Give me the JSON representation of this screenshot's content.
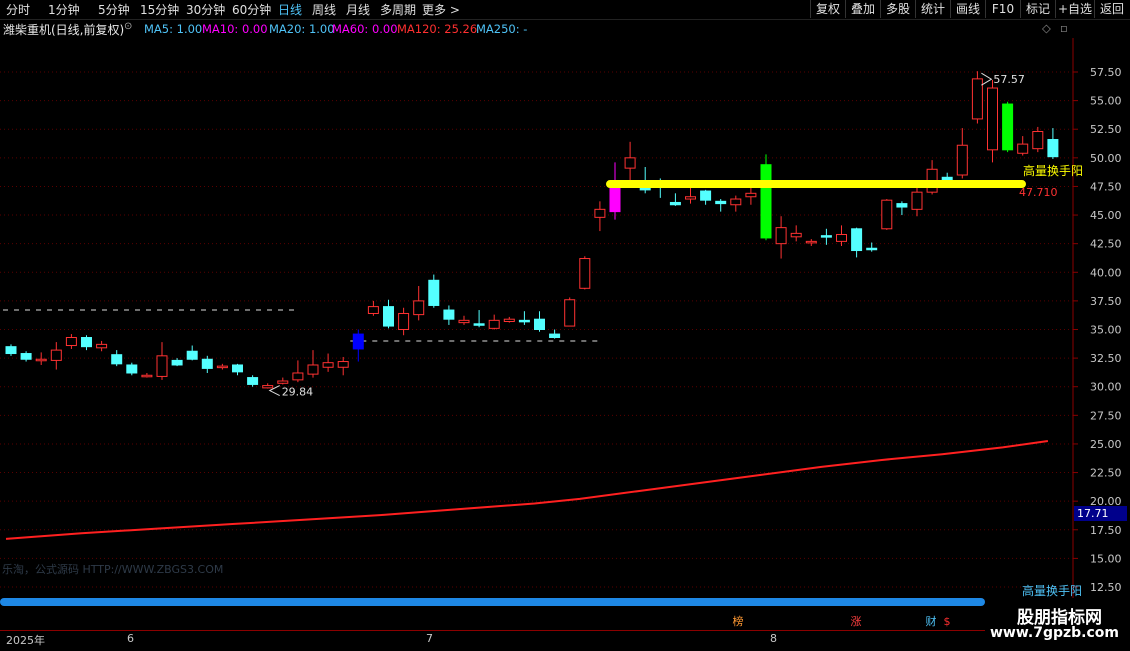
{
  "toolbar": {
    "tabs": [
      "分时",
      "1分钟",
      "5分钟",
      "15分钟",
      "30分钟",
      "60分钟",
      "日线",
      "周线",
      "月线",
      "多周期",
      "更多 >"
    ],
    "active_tab": "日线",
    "right_buttons": [
      "复权",
      "叠加",
      "多股",
      "统计",
      "画线",
      "F10",
      "标记",
      "+自选",
      "返回"
    ]
  },
  "title": {
    "stock": "潍柴重机(日线,前复权)",
    "ma_items": [
      {
        "label": "MA5: 1.00",
        "color": "#4fc3f7"
      },
      {
        "label": "MA10: 0.00",
        "color": "#ff00ff"
      },
      {
        "label": "MA20: 1.00",
        "color": "#4fc3f7"
      },
      {
        "label": "MA60: 0.00",
        "color": "#ff00ff"
      },
      {
        "label": "MA120: 25.26",
        "color": "#ff3030"
      },
      {
        "label": "MA250: -",
        "color": "#4fc3f7"
      }
    ]
  },
  "annotations": {
    "high": "57.57",
    "low": "29.84",
    "signal": "高量换手阳",
    "signal_value": "47.710",
    "current_price": "17.71",
    "signal_bottom": "高量换手阳"
  },
  "watermark": "乐淘，公式源码 HTTP://WWW.ZBGS3.COM",
  "dates": [
    "2025年",
    "6",
    "7",
    "8"
  ],
  "markers": [
    {
      "text": "榜",
      "color": "#ff9933"
    },
    {
      "text": "涨",
      "color": "#ff4040"
    },
    {
      "text": "财",
      "color": "#4fc3f7"
    },
    {
      "text": "$",
      "color": "#ff3030"
    }
  ],
  "logo": {
    "name": "股朋指标网",
    "url": "www.7gpzb.com"
  },
  "colors": {
    "up": "#ff3232",
    "down": "#54ffff",
    "ma120": "#ff2020",
    "signal_line": "#ffff00"
  },
  "chart_data": {
    "type": "candlestick",
    "ylim": [
      12.5,
      57.5
    ],
    "yticks": [
      "57.50",
      "55.00",
      "52.50",
      "50.00",
      "47.50",
      "45.00",
      "42.50",
      "40.00",
      "37.50",
      "35.00",
      "32.50",
      "30.00",
      "27.50",
      "25.00",
      "22.50",
      "20.00",
      "17.50",
      "15.00",
      "12.50"
    ],
    "high_marker": 57.57,
    "low_marker": 29.84,
    "signal_level": 47.71,
    "candles": [
      {
        "o": 33.5,
        "c": 32.9,
        "h": 33.7,
        "l": 32.7
      },
      {
        "o": 32.9,
        "c": 32.4,
        "h": 33.1,
        "l": 32.2
      },
      {
        "o": 32.3,
        "c": 32.4,
        "h": 33.0,
        "l": 31.9
      },
      {
        "o": 32.3,
        "c": 33.2,
        "h": 33.9,
        "l": 31.5
      },
      {
        "o": 33.6,
        "c": 34.3,
        "h": 34.6,
        "l": 33.3
      },
      {
        "o": 34.3,
        "c": 33.5,
        "h": 34.5,
        "l": 33.2
      },
      {
        "o": 33.4,
        "c": 33.7,
        "h": 34.0,
        "l": 33.1
      },
      {
        "o": 32.8,
        "c": 32.0,
        "h": 33.2,
        "l": 31.8
      },
      {
        "o": 31.9,
        "c": 31.2,
        "h": 32.1,
        "l": 31.0
      },
      {
        "o": 30.9,
        "c": 31.0,
        "h": 31.2,
        "l": 30.8
      },
      {
        "o": 30.9,
        "c": 32.7,
        "h": 33.9,
        "l": 30.6
      },
      {
        "o": 32.3,
        "c": 31.9,
        "h": 32.5,
        "l": 31.8
      },
      {
        "o": 33.1,
        "c": 32.4,
        "h": 33.6,
        "l": 32.3
      },
      {
        "o": 32.4,
        "c": 31.6,
        "h": 32.7,
        "l": 31.2
      },
      {
        "o": 31.7,
        "c": 31.8,
        "h": 32.0,
        "l": 31.5
      },
      {
        "o": 31.9,
        "c": 31.3,
        "h": 32.0,
        "l": 31.0
      },
      {
        "o": 30.8,
        "c": 30.2,
        "h": 31.0,
        "l": 30.0
      },
      {
        "o": 29.9,
        "c": 30.1,
        "h": 30.3,
        "l": 29.84
      },
      {
        "o": 30.3,
        "c": 30.5,
        "h": 30.8,
        "l": 30.2
      },
      {
        "o": 30.6,
        "c": 31.2,
        "h": 32.3,
        "l": 30.4
      },
      {
        "o": 31.1,
        "c": 31.9,
        "h": 33.2,
        "l": 30.8
      },
      {
        "o": 31.7,
        "c": 32.1,
        "h": 32.9,
        "l": 31.3
      },
      {
        "o": 31.7,
        "c": 32.2,
        "h": 32.6,
        "l": 31.0
      },
      {
        "o": 33.3,
        "c": 34.6,
        "h": 35.0,
        "l": 32.2,
        "color": "#0000ff"
      },
      {
        "o": 36.4,
        "c": 37.0,
        "h": 37.5,
        "l": 36.2
      },
      {
        "o": 37.0,
        "c": 35.3,
        "h": 37.6,
        "l": 35.1
      },
      {
        "o": 35.0,
        "c": 36.4,
        "h": 36.9,
        "l": 34.5
      },
      {
        "o": 36.3,
        "c": 37.5,
        "h": 38.8,
        "l": 35.8
      },
      {
        "o": 39.3,
        "c": 37.1,
        "h": 39.8,
        "l": 36.9
      },
      {
        "o": 36.7,
        "c": 35.9,
        "h": 37.1,
        "l": 35.4
      },
      {
        "o": 35.6,
        "c": 35.8,
        "h": 36.2,
        "l": 35.4
      },
      {
        "o": 35.5,
        "c": 35.4,
        "h": 36.7,
        "l": 35.2
      },
      {
        "o": 35.1,
        "c": 35.8,
        "h": 36.3,
        "l": 35.0
      },
      {
        "o": 35.7,
        "c": 35.9,
        "h": 36.1,
        "l": 35.6
      },
      {
        "o": 35.8,
        "c": 35.7,
        "h": 36.6,
        "l": 35.4
      },
      {
        "o": 35.9,
        "c": 35.0,
        "h": 36.6,
        "l": 34.8
      },
      {
        "o": 34.6,
        "c": 34.3,
        "h": 35.0,
        "l": 34.2
      },
      {
        "o": 35.3,
        "c": 37.6,
        "h": 37.8,
        "l": 35.3
      },
      {
        "o": 38.6,
        "c": 41.2,
        "h": 41.4,
        "l": 38.5
      },
      {
        "o": 44.8,
        "c": 45.5,
        "h": 46.2,
        "l": 43.6
      },
      {
        "o": 45.3,
        "c": 47.9,
        "h": 49.6,
        "l": 44.6,
        "color": "#ff00ff"
      },
      {
        "o": 49.1,
        "c": 50.0,
        "h": 51.4,
        "l": 47.8
      },
      {
        "o": 47.5,
        "c": 47.2,
        "h": 49.2,
        "l": 46.9
      },
      {
        "o": 47.7,
        "c": 47.5,
        "h": 48.2,
        "l": 46.5
      },
      {
        "o": 46.1,
        "c": 45.9,
        "h": 46.9,
        "l": 45.8
      },
      {
        "o": 46.4,
        "c": 46.6,
        "h": 47.5,
        "l": 46.0
      },
      {
        "o": 47.1,
        "c": 46.3,
        "h": 47.2,
        "l": 45.9
      },
      {
        "o": 46.2,
        "c": 46.0,
        "h": 46.4,
        "l": 45.3
      },
      {
        "o": 45.9,
        "c": 46.4,
        "h": 46.7,
        "l": 45.3
      },
      {
        "o": 46.6,
        "c": 46.9,
        "h": 48.0,
        "l": 45.9
      },
      {
        "o": 49.4,
        "c": 43.0,
        "h": 50.3,
        "l": 42.8,
        "color": "#00ff00"
      },
      {
        "o": 42.5,
        "c": 43.9,
        "h": 44.9,
        "l": 41.2
      },
      {
        "o": 43.1,
        "c": 43.4,
        "h": 44.1,
        "l": 42.7
      },
      {
        "o": 42.6,
        "c": 42.7,
        "h": 42.9,
        "l": 42.3
      },
      {
        "o": 43.2,
        "c": 43.1,
        "h": 43.8,
        "l": 42.4
      },
      {
        "o": 42.7,
        "c": 43.3,
        "h": 44.1,
        "l": 42.3
      },
      {
        "o": 43.8,
        "c": 41.9,
        "h": 43.9,
        "l": 41.3
      },
      {
        "o": 42.1,
        "c": 42.0,
        "h": 42.6,
        "l": 41.8
      },
      {
        "o": 43.8,
        "c": 46.3,
        "h": 46.4,
        "l": 43.7
      },
      {
        "o": 46.0,
        "c": 45.7,
        "h": 46.2,
        "l": 45.0
      },
      {
        "o": 45.5,
        "c": 47.0,
        "h": 47.9,
        "l": 44.9
      },
      {
        "o": 47.0,
        "c": 49.0,
        "h": 49.8,
        "l": 46.8
      },
      {
        "o": 48.3,
        "c": 48.0,
        "h": 48.7,
        "l": 47.8
      },
      {
        "o": 48.5,
        "c": 51.1,
        "h": 52.6,
        "l": 48.2
      },
      {
        "o": 53.4,
        "c": 56.9,
        "h": 57.57,
        "l": 53.0
      },
      {
        "o": 50.7,
        "c": 56.1,
        "h": 56.8,
        "l": 49.6
      },
      {
        "o": 54.7,
        "c": 50.7,
        "h": 54.9,
        "l": 50.5,
        "color": "#00ff00"
      },
      {
        "o": 50.4,
        "c": 51.2,
        "h": 51.9,
        "l": 50.2
      },
      {
        "o": 50.8,
        "c": 52.3,
        "h": 52.7,
        "l": 50.5
      },
      {
        "o": 51.6,
        "c": 50.1,
        "h": 52.6,
        "l": 49.9
      }
    ],
    "ma120": [
      [
        0,
        16.7
      ],
      [
        5,
        17.2
      ],
      [
        10,
        17.6
      ],
      [
        15,
        18.0
      ],
      [
        20,
        18.4
      ],
      [
        25,
        18.8
      ],
      [
        30,
        19.3
      ],
      [
        35,
        19.8
      ],
      [
        38,
        20.2
      ],
      [
        42,
        20.9
      ],
      [
        46,
        21.6
      ],
      [
        50,
        22.3
      ],
      [
        54,
        23.0
      ],
      [
        58,
        23.6
      ],
      [
        62,
        24.1
      ],
      [
        66,
        24.7
      ],
      [
        69,
        25.26
      ]
    ],
    "dashed_levels": [
      {
        "value": 36.7,
        "x0": 0,
        "x1": 19
      },
      {
        "value": 34.0,
        "x0": 23,
        "x1": 39
      }
    ]
  }
}
